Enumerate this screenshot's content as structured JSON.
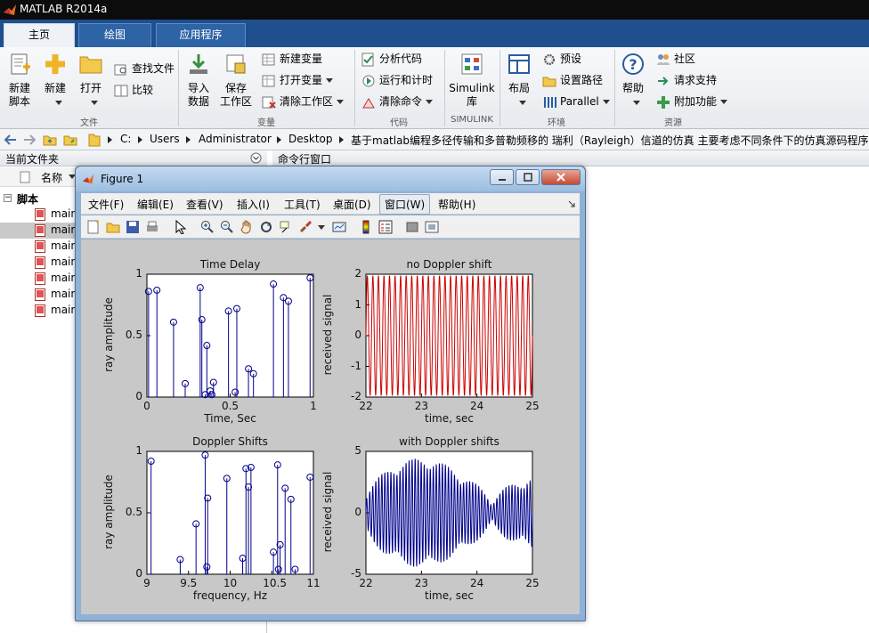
{
  "window": {
    "title": "MATLAB R2014a"
  },
  "tabs": [
    {
      "label": "主页",
      "active": true
    },
    {
      "label": "绘图",
      "active": false
    },
    {
      "label": "应用程序",
      "active": false
    }
  ],
  "ribbon": {
    "file": {
      "new_script": [
        "新建",
        "脚本"
      ],
      "new": "新建",
      "open": "打开",
      "find_files": "查找文件",
      "compare": "比较",
      "group": "文件"
    },
    "variable": {
      "import": [
        "导入",
        "数据"
      ],
      "save": [
        "保存",
        "工作区"
      ],
      "new_var": "新建变量",
      "open_var": "打开变量",
      "clear_ws": "清除工作区",
      "group": "变量"
    },
    "code": {
      "analyze": "分析代码",
      "run_time": "运行和计时",
      "clear_cmd": "清除命令",
      "group": "代码"
    },
    "simulink": {
      "lib": [
        "Simulink",
        "库"
      ],
      "group": "SIMULINK"
    },
    "env": {
      "layout": "布局",
      "prefs": "预设",
      "set_path": "设置路径",
      "parallel": "Parallel",
      "group": "环境"
    },
    "resources": {
      "help": "帮助",
      "community": "社区",
      "support": "请求支持",
      "addons": "附加功能",
      "group": "资源"
    }
  },
  "address": {
    "segments": [
      "C:",
      "Users",
      "Administrator",
      "Desktop",
      "基于matlab编程多径传输和多普勒频移的 瑞利（Rayleigh）信道的仿真 主要考虑不同条件下的仿真源码程序"
    ]
  },
  "current_folder": {
    "title": "当前文件夹",
    "col_name": "名称",
    "group": "脚本",
    "files": [
      "main",
      "main",
      "main",
      "main",
      "main",
      "main",
      "main"
    ]
  },
  "command_window": {
    "title": "命令行窗口"
  },
  "figure": {
    "title": "Figure 1",
    "menu": [
      "文件(F)",
      "编辑(E)",
      "查看(V)",
      "插入(I)",
      "工具(T)",
      "桌面(D)",
      "窗口(W)",
      "帮助(H)"
    ],
    "colors": {
      "stem": "#00008b",
      "red": "#cc0000",
      "blue": "#00008b"
    }
  },
  "chart_data": [
    {
      "type": "stem",
      "title": "Time Delay",
      "xlabel": "Time, Sec",
      "ylabel": "ray amplitude",
      "xlim": [
        0,
        1
      ],
      "ylim": [
        0,
        1
      ],
      "xticks": [
        "0",
        "0.5",
        "1"
      ],
      "yticks": [
        "0",
        "0.5",
        "1"
      ],
      "x": [
        0.01,
        0.06,
        0.16,
        0.23,
        0.32,
        0.33,
        0.35,
        0.36,
        0.38,
        0.39,
        0.4,
        0.49,
        0.53,
        0.54,
        0.61,
        0.64,
        0.76,
        0.82,
        0.85,
        0.98
      ],
      "y": [
        0.86,
        0.87,
        0.61,
        0.11,
        0.89,
        0.63,
        0.02,
        0.42,
        0.05,
        0.02,
        0.12,
        0.7,
        0.04,
        0.72,
        0.23,
        0.19,
        0.92,
        0.81,
        0.78,
        0.97
      ]
    },
    {
      "type": "line",
      "title": "no Doppler shift",
      "xlabel": "time, sec",
      "ylabel": "received signal",
      "xlim": [
        22,
        25
      ],
      "ylim": [
        -2,
        2
      ],
      "xticks": [
        "22",
        "23",
        "24",
        "25"
      ],
      "yticks": [
        "-2",
        "-1",
        "0",
        "1",
        "2"
      ],
      "signal": {
        "amplitude": 1.95,
        "cycles": 30
      }
    },
    {
      "type": "stem",
      "title": "Doppler Shifts",
      "xlabel": "frequency, Hz",
      "ylabel": "ray amplitude",
      "xlim": [
        9,
        11
      ],
      "ylim": [
        0,
        1
      ],
      "xticks": [
        "9",
        "9.5",
        "10",
        "10.5",
        "11"
      ],
      "yticks": [
        "0",
        "0.5",
        "1"
      ],
      "x": [
        9.05,
        9.4,
        9.59,
        9.7,
        9.72,
        9.73,
        9.96,
        10.15,
        10.19,
        10.22,
        10.25,
        10.52,
        10.57,
        10.58,
        10.6,
        10.66,
        10.73,
        10.78,
        10.96
      ],
      "y": [
        0.92,
        0.12,
        0.41,
        0.97,
        0.06,
        0.62,
        0.78,
        0.13,
        0.86,
        0.71,
        0.87,
        0.18,
        0.89,
        0.04,
        0.24,
        0.7,
        0.61,
        0.04,
        0.79
      ]
    },
    {
      "type": "line",
      "title": "with Doppler shifts",
      "xlabel": "time, sec",
      "ylabel": "received signal",
      "xlim": [
        22,
        25
      ],
      "ylim": [
        -5,
        5
      ],
      "xticks": [
        "22",
        "23",
        "24",
        "25"
      ],
      "yticks": [
        "-5",
        "0",
        "5"
      ],
      "signal": {
        "cycles": 55
      }
    }
  ]
}
